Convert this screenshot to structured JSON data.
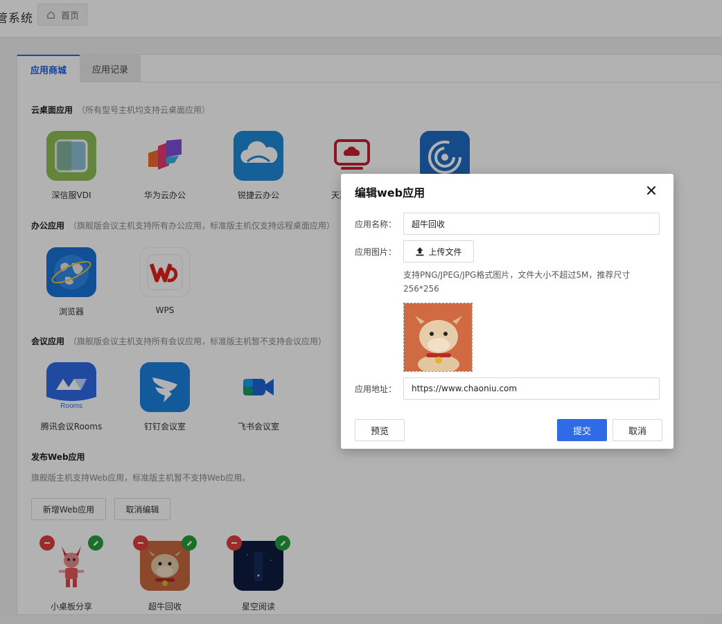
{
  "header": {
    "app_title": "管系统",
    "home_tab": "首页"
  },
  "tabs": [
    {
      "label": "应用商城",
      "active": true
    },
    {
      "label": "应用记录",
      "active": false
    }
  ],
  "sections": {
    "cloud_desktop": {
      "title": "云桌面应用",
      "note": "（所有型号主机均支持云桌面应用）",
      "apps": [
        "深信服VDI",
        "华为云办公",
        "锐捷云办公",
        "天翼云电脑",
        ""
      ]
    },
    "office": {
      "title": "办公应用",
      "note": "（旗舰版会议主机支持所有办公应用，标准版主机仅支持远程桌面应用）",
      "apps": [
        "浏览器",
        "WPS"
      ]
    },
    "meeting": {
      "title": "会议应用",
      "note": "（旗舰版会议主机支持所有会议应用，标准版主机暂不支持会议应用）",
      "apps": [
        "腾讯会议Rooms",
        "钉钉会议室",
        "飞书会议室"
      ],
      "rooms_text": "Rooms"
    },
    "web": {
      "title": "发布Web应用",
      "desc": "旗舰版主机支持Web应用，标准版主机暂不支持Web应用。",
      "add_button": "新增Web应用",
      "cancel_edit_button": "取消编辑",
      "apps": [
        "小桌板分享",
        "超牛回收",
        "星空阅读"
      ]
    }
  },
  "modal": {
    "title": "编辑web应用",
    "name_label": "应用名称：",
    "name_value": "超牛回收",
    "image_label": "应用图片：",
    "upload_label": "上传文件",
    "hint": "支持PNG/JPEG/JPG格式图片，文件大小不超过5M，推荐尺寸256*256",
    "url_label": "应用地址：",
    "url_value": "https://www.chaoniu.com",
    "preview_button": "预览",
    "submit_button": "提交",
    "cancel_button": "取消"
  },
  "colors": {
    "primary": "#2f6be6",
    "delete_badge": "#e04040",
    "edit_badge": "#21a03a"
  }
}
